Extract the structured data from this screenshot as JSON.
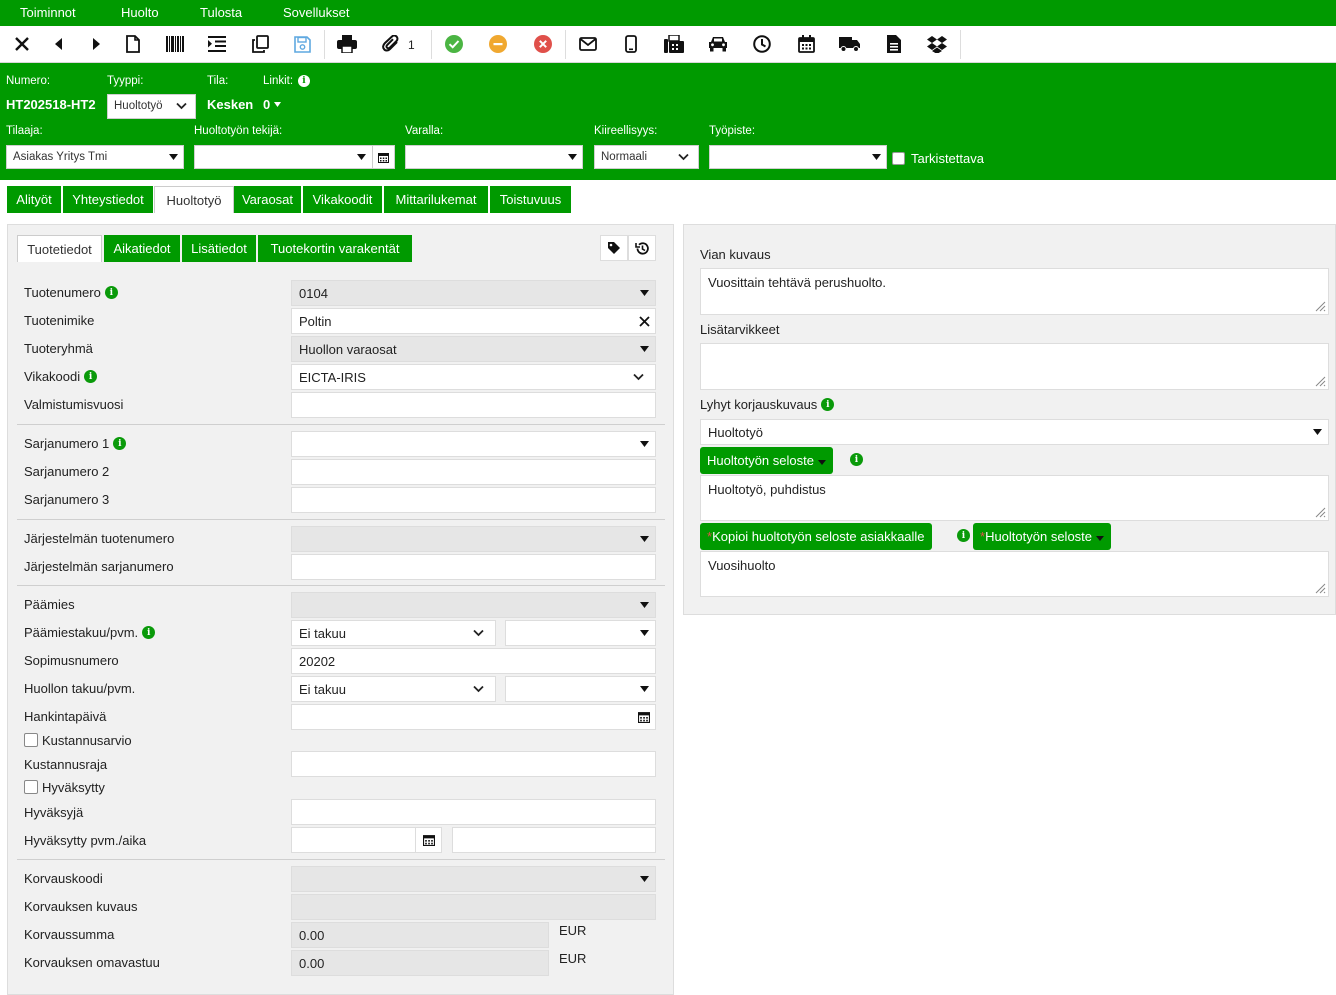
{
  "menu": [
    "Toiminnot",
    "Huolto",
    "Tulosta",
    "Sovellukset"
  ],
  "toolbar": {
    "icons": [
      "close-icon",
      "back-icon",
      "forward-icon",
      "document-icon",
      "barcode-icon",
      "indent-icon",
      "copy-icon",
      "save-icon",
      "print-icon",
      "paperclip-icon",
      "ok-icon",
      "pending-icon",
      "cancel-icon",
      "mail-icon",
      "phone-icon",
      "fax-icon",
      "car-icon",
      "clock-icon",
      "calendar-icon",
      "truck-icon",
      "file-icon",
      "dropbox-icon"
    ],
    "attachment_count": "1",
    "status_colors": {
      "ok": "#4bb543",
      "pending": "#f0a830",
      "cancel": "#e0504a"
    }
  },
  "header": {
    "numero_label": "Numero:",
    "numero_value": "HT202518-HT2",
    "tyyppi_label": "Tyyppi:",
    "tyyppi_value": "Huoltotyö",
    "tila_label": "Tila:",
    "tila_value": "Kesken",
    "linkit_label": "Linkit:",
    "linkit_value": "0",
    "tilaaja_label": "Tilaaja:",
    "tilaaja_value": "Asiakas Yritys Tmi",
    "tekija_label": "Huoltotyön tekijä:",
    "tekija_value": "",
    "varalla_label": "Varalla:",
    "varalla_value": "",
    "kiireellisyys_label": "Kiireellisyys:",
    "kiireellisyys_value": "Normaali",
    "tyopiste_label": "Työpiste:",
    "tyopiste_value": "",
    "tarkistettava_label": "Tarkistettava"
  },
  "main_tabs": [
    "Alityöt",
    "Yhteystiedot",
    "Huoltotyö",
    "Varaosat",
    "Vikakoodit",
    "Mittarilukemat",
    "Toistuvuus"
  ],
  "sub_tabs": [
    "Tuotetiedot",
    "Aikatiedot",
    "Lisätiedot",
    "Tuotekortin varakentät"
  ],
  "fields": {
    "tuotenumero": {
      "label": "Tuotenumero",
      "value": "0104"
    },
    "tuotenimike": {
      "label": "Tuotenimike",
      "value": "Poltin"
    },
    "tuoteryhma": {
      "label": "Tuoteryhmä",
      "value": "Huollon varaosat"
    },
    "vikakoodi": {
      "label": "Vikakoodi",
      "value": "EICTA-IRIS"
    },
    "valmistumisvuosi": {
      "label": "Valmistumisvuosi",
      "value": ""
    },
    "sarjanumero1": {
      "label": "Sarjanumero 1",
      "value": ""
    },
    "sarjanumero2": {
      "label": "Sarjanumero 2",
      "value": ""
    },
    "sarjanumero3": {
      "label": "Sarjanumero 3",
      "value": ""
    },
    "jarj_tuotenumero": {
      "label": "Järjestelmän tuotenumero",
      "value": ""
    },
    "jarj_sarjanumero": {
      "label": "Järjestelmän sarjanumero",
      "value": ""
    },
    "paamies": {
      "label": "Päämies",
      "value": ""
    },
    "paamiestakuu": {
      "label": "Päämiestakuu/pvm.",
      "value": "Ei takuu",
      "date": ""
    },
    "sopimusnumero": {
      "label": "Sopimusnumero",
      "value": "20202"
    },
    "huollon_takuu": {
      "label": "Huollon takuu/pvm.",
      "value": "Ei takuu",
      "date": ""
    },
    "hankintapaiva": {
      "label": "Hankintapäivä",
      "value": ""
    },
    "kustannusarvio": {
      "label": "Kustannusarvio"
    },
    "kustannusraja": {
      "label": "Kustannusraja",
      "value": ""
    },
    "hyvaksytty": {
      "label": "Hyväksytty"
    },
    "hyvaksyja": {
      "label": "Hyväksyjä",
      "value": ""
    },
    "hyvaksytty_pvm": {
      "label": "Hyväksytty pvm./aika",
      "date": "",
      "time": ""
    },
    "korvauskoodi": {
      "label": "Korvauskoodi",
      "value": ""
    },
    "korvauksen_kuvaus": {
      "label": "Korvauksen kuvaus",
      "value": ""
    },
    "korvaussumma": {
      "label": "Korvaussumma",
      "value": "0.00",
      "currency": "EUR"
    },
    "korvauksen_omavastuu": {
      "label": "Korvauksen omavastuu",
      "value": "0.00",
      "currency": "EUR"
    }
  },
  "right": {
    "vian_kuvaus_label": "Vian kuvaus",
    "vian_kuvaus_value": "Vuosittain tehtävä perushuolto.",
    "lisatarvikkeet_label": "Lisätarvikkeet",
    "lisatarvikkeet_value": "",
    "lyhyt_label": "Lyhyt korjauskuvaus",
    "lyhyt_value": "Huoltotyö",
    "seloste_button": "Huoltotyön seloste",
    "seloste_value": "Huoltotyö, puhdistus",
    "kopioi_button": "Kopioi huoltotyön seloste asiakkaalle",
    "seloste2_button": "Huoltotyön seloste",
    "asiakas_value": "Vuosihuolto",
    "required_mark": "*"
  },
  "colors": {
    "brand_green": "#009a00"
  }
}
